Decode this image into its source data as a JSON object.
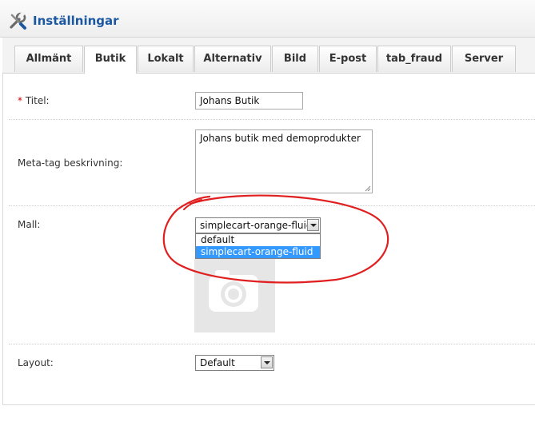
{
  "header": {
    "title": "Inställningar",
    "icon": "wrench-screwdriver-icon",
    "title_color": "#1b58a0"
  },
  "tabs": [
    {
      "label": "Allmänt",
      "active": false
    },
    {
      "label": "Butik",
      "active": true
    },
    {
      "label": "Lokalt",
      "active": false
    },
    {
      "label": "Alternativ",
      "active": false
    },
    {
      "label": "Bild",
      "active": false
    },
    {
      "label": "E-post",
      "active": false
    },
    {
      "label": "tab_fraud",
      "active": false
    },
    {
      "label": "Server",
      "active": false
    }
  ],
  "form": {
    "required_marker": "*",
    "title_label": "Titel:",
    "title_value": "Johans Butik",
    "meta_label": "Meta-tag beskrivning:",
    "meta_value": "Johans butik med demoprodukter",
    "template_label": "Mall:",
    "template_selected": "simplecart-orange-fluid",
    "template_options": [
      "default",
      "simplecart-orange-fluid"
    ],
    "template_highlighted": "simplecart-orange-fluid",
    "layout_label": "Layout:",
    "layout_selected": "Default"
  },
  "annotation": {
    "shape": "hand-drawn red circle",
    "color": "#e02020"
  },
  "colors": {
    "selection": "#3399ff",
    "required": "#cc0000"
  }
}
